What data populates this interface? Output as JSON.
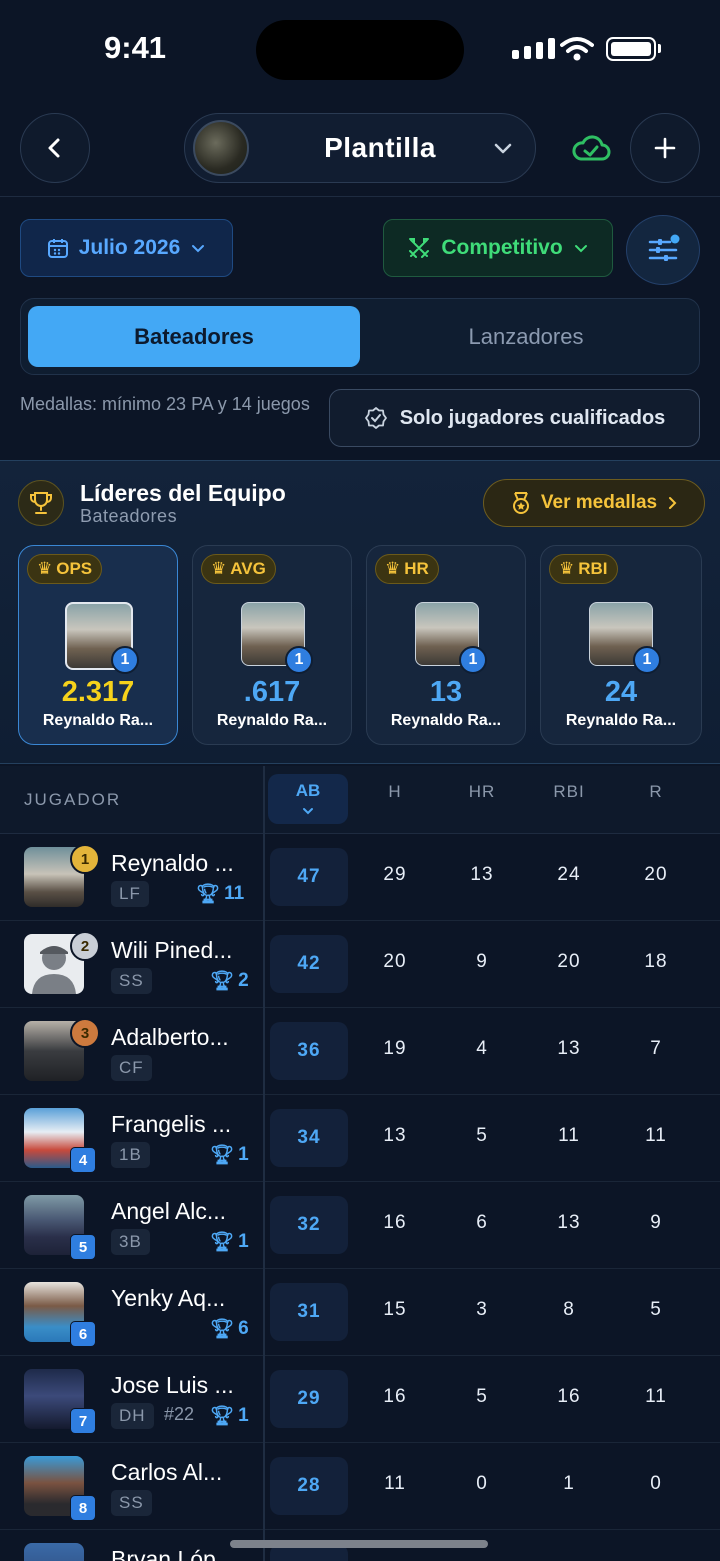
{
  "status": {
    "time": "9:41"
  },
  "header": {
    "team_name": "Plantilla"
  },
  "filters": {
    "date_label": "Julio 2026",
    "mode_label": "Competitivo",
    "tabs": [
      "Bateadores",
      "Lanzadores"
    ],
    "medal_note": "Medallas: mínimo 23 PA y 14 juegos",
    "qualified_label": "Solo jugadores cualificados"
  },
  "leaders": {
    "title": "Líderes del Equipo",
    "subtitle": "Bateadores",
    "medals_button": "Ver medallas",
    "cards": [
      {
        "stat": "OPS",
        "value": "2.317",
        "name": "Reynaldo Ra...",
        "rank": "1"
      },
      {
        "stat": "AVG",
        "value": ".617",
        "name": "Reynaldo Ra...",
        "rank": "1"
      },
      {
        "stat": "HR",
        "value": "13",
        "name": "Reynaldo Ra...",
        "rank": "1"
      },
      {
        "stat": "RBI",
        "value": "24",
        "name": "Reynaldo Ra...",
        "rank": "1"
      }
    ]
  },
  "table": {
    "player_header": "JUGADOR",
    "columns": [
      "AB",
      "H",
      "HR",
      "RBI",
      "R"
    ],
    "rows": [
      {
        "name": "Reynaldo ...",
        "pos": "LF",
        "jersey": "",
        "trophies": "11",
        "rank": "1",
        "ab": "47",
        "h": "29",
        "hr": "13",
        "rbi": "24",
        "r": "20"
      },
      {
        "name": "Wili Pined...",
        "pos": "SS",
        "jersey": "",
        "trophies": "2",
        "rank": "2",
        "ab": "42",
        "h": "20",
        "hr": "9",
        "rbi": "20",
        "r": "18"
      },
      {
        "name": "Adalberto...",
        "pos": "CF",
        "jersey": "",
        "trophies": "",
        "rank": "3",
        "ab": "36",
        "h": "19",
        "hr": "4",
        "rbi": "13",
        "r": "7"
      },
      {
        "name": "Frangelis ...",
        "pos": "1B",
        "jersey": "",
        "trophies": "1",
        "rank": "4",
        "ab": "34",
        "h": "13",
        "hr": "5",
        "rbi": "11",
        "r": "11"
      },
      {
        "name": "Angel Alc...",
        "pos": "3B",
        "jersey": "",
        "trophies": "1",
        "rank": "5",
        "ab": "32",
        "h": "16",
        "hr": "6",
        "rbi": "13",
        "r": "9"
      },
      {
        "name": "Yenky Aq...",
        "pos": "",
        "jersey": "",
        "trophies": "6",
        "rank": "6",
        "ab": "31",
        "h": "15",
        "hr": "3",
        "rbi": "8",
        "r": "5"
      },
      {
        "name": "Jose Luis ...",
        "pos": "DH",
        "jersey": "#22",
        "trophies": "1",
        "rank": "7",
        "ab": "29",
        "h": "16",
        "hr": "5",
        "rbi": "16",
        "r": "11"
      },
      {
        "name": "Carlos Al...",
        "pos": "SS",
        "jersey": "",
        "trophies": "",
        "rank": "8",
        "ab": "28",
        "h": "11",
        "hr": "0",
        "rbi": "1",
        "r": "0"
      },
      {
        "name": "Bryan Lóp",
        "pos": "",
        "jersey": "",
        "trophies": "",
        "rank": "",
        "ab": "",
        "h": "",
        "hr": "",
        "rbi": "",
        "r": ""
      }
    ]
  },
  "colors": {
    "accent": "#43a8f5",
    "green": "#3fdc79",
    "gold": "#f5c33b",
    "bg": "#0c1526"
  }
}
